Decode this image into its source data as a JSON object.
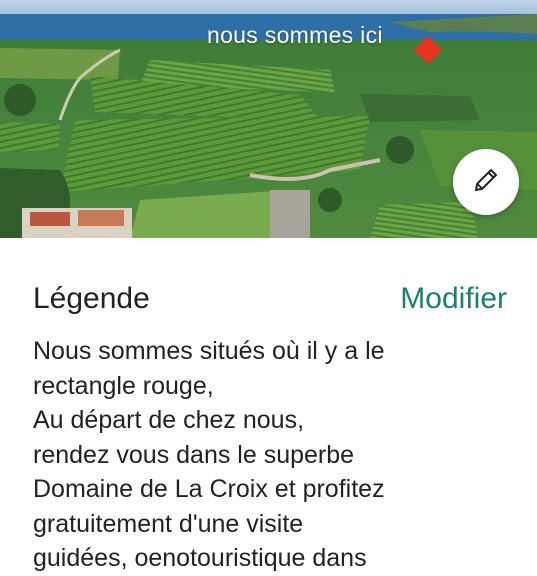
{
  "photo": {
    "overlay_text": "nous sommes ici",
    "marker_color": "#e8331f"
  },
  "edit_button": {
    "icon": "pencil-icon"
  },
  "legend": {
    "title": "Légende",
    "modify_label": "Modifier",
    "accent_color": "#1a7f74",
    "lines": [
      "Nous sommes situés où il y a le",
      "rectangle rouge,",
      "Au départ de chez nous,",
      "rendez vous dans le superbe",
      "Domaine de La Croix et profitez",
      "gratuitement d'une visite",
      "guidées, oenotouristique dans"
    ]
  }
}
